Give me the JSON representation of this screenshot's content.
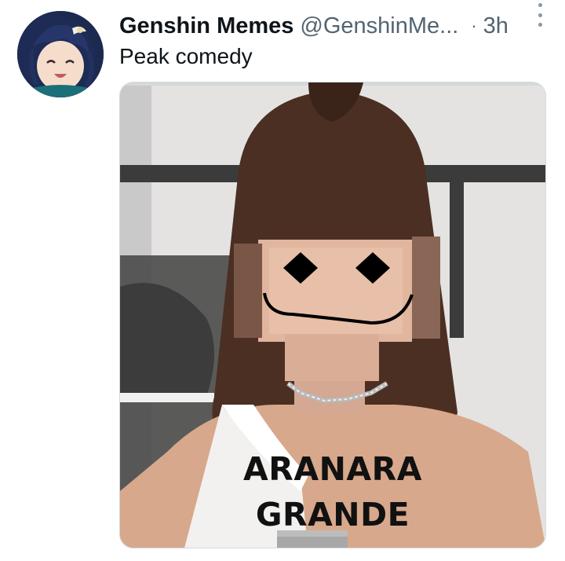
{
  "author": {
    "display_name": "Genshin Memes",
    "handle": "@GenshinMe...",
    "timestamp": "3h"
  },
  "tweet": {
    "text": "Peak comedy"
  },
  "media": {
    "caption_line1": "ARANARA",
    "caption_line2": "GRANDE"
  },
  "icons": {
    "more": "more-vertical-icon",
    "avatar": "anime-avatar"
  }
}
